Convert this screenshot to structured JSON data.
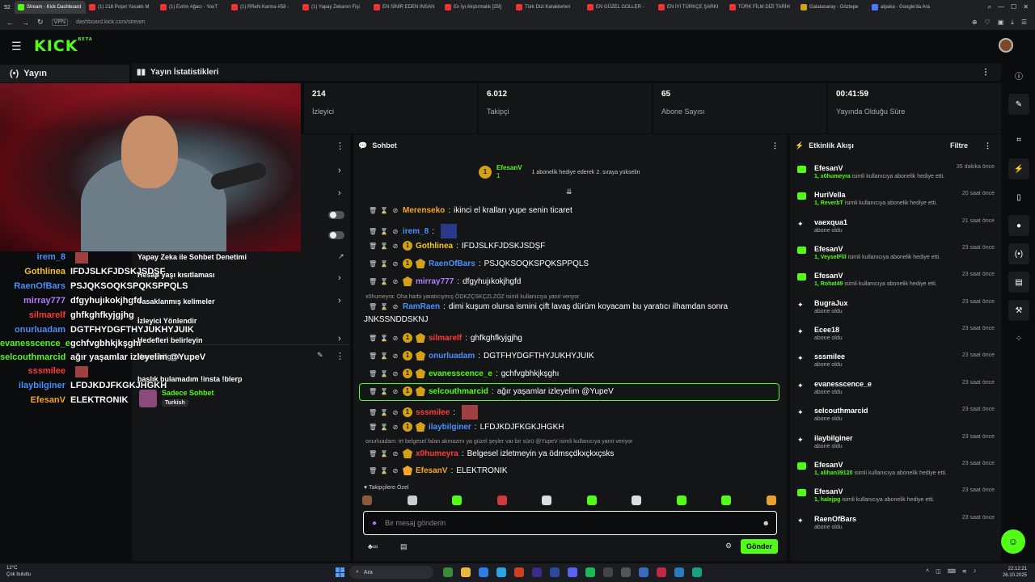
{
  "browser": {
    "tab_count": "52",
    "tabs": [
      {
        "label": "Stream - Kick Dashboard",
        "color": "g",
        "active": true
      },
      {
        "label": "(1) 218 Poşet Yasaklı M",
        "color": "r"
      },
      {
        "label": "(1) Evrim Ağacı - YouT",
        "color": "r"
      },
      {
        "label": "(1) RReN Karma #58 -",
        "color": "r"
      },
      {
        "label": "(1) Yapay Zekanın Fişi",
        "color": "r"
      },
      {
        "label": "EN SİNİR EDEN İNSAN",
        "color": "r"
      },
      {
        "label": "En İyi Alıştırmalık [25t]",
        "color": "r"
      },
      {
        "label": "Türk Dizi Karakterleri",
        "color": "r"
      },
      {
        "label": "EN GÜZEL GOLLER -",
        "color": "r"
      },
      {
        "label": "EN İYİ TÜRKÇE ŞARKI",
        "color": "r"
      },
      {
        "label": "TÜRK FİLM DİZİ TARİH",
        "color": "r"
      },
      {
        "label": "Galatasaray - Göztepe",
        "color": "y"
      },
      {
        "label": "alpaka - Google'da Ara",
        "color": "b"
      }
    ],
    "url_prefix": "VPN",
    "url": "dashboard.kick.com/stream"
  },
  "header": {
    "logo": "KICK",
    "logo_sup": "BETA"
  },
  "left_nav": {
    "label": "Yayın"
  },
  "stats": {
    "title": "Yayın İstatistikleri",
    "items": [
      {
        "value": "214",
        "label": "İzleyici"
      },
      {
        "value": "6.012",
        "label": "Takipçi"
      },
      {
        "value": "65",
        "label": "Abone Sayısı"
      },
      {
        "value": "00:41:59",
        "label": "Yayında Olduğu Süre"
      }
    ]
  },
  "overlay_chat": [
    {
      "user": "irem_8",
      "text": "",
      "color": "#4a90ff"
    },
    {
      "user": "Gothlinea",
      "text": "IFDJSLKFJDSKJSDŞF",
      "color": "#f5c518"
    },
    {
      "user": "RaenOfBars",
      "text": "PSJQKSOQKSPQKSPPQLS",
      "color": "#4a90ff"
    },
    {
      "user": "mirray777",
      "text": "dfgyhujıkokjhgfd",
      "color": "#b57cff"
    },
    {
      "user": "silmarelf",
      "text": "ghfkghfkyjgjhg",
      "color": "#ff3b3b"
    },
    {
      "user": "onurluadam",
      "text": "DGTFHYDGFTHYJUKHYJUIK",
      "color": "#4a90ff"
    },
    {
      "user": "evanesscence_e",
      "text": "gchfvgbhkjkşghı",
      "color": "#53fc18"
    },
    {
      "user": "selcouthmarcid",
      "text": "ağır yaşamlar izleyelim @YupeV",
      "color": "#53fc18"
    },
    {
      "user": "sssmilee",
      "text": "",
      "color": "#ff3b3b"
    },
    {
      "user": "ilaybilginer",
      "text": "LFDJKDJFKGKJHGKH",
      "color": "#4a90ff"
    },
    {
      "user": "EfesanV",
      "text": "ELEKTRONIK",
      "color": "#f5a623"
    }
  ],
  "mid_panel": {
    "ai_title": "Yapay Zeka ile Sohbet Denetimi",
    "age_limit": "Hesap yaşı kısıtlaması",
    "banned_words": "Yasaklanmış kelimeler",
    "redirect": "İzleyici Yönlendir",
    "redirect_sub": "Hedefleri belirleyin",
    "info_title": "Yayın bilgisi",
    "stream_title": "başlık bulamadım !insta !blerp",
    "mode": "Sadece Sohbet",
    "language": "Turkish"
  },
  "chat": {
    "title": "Sohbet",
    "pinned_user": "EfesanV",
    "pinned_level": "1",
    "pinned_text": "1 abonelik hediye ederek 2. sıraya yükselin",
    "messages": [
      {
        "user": "Merenseko",
        "text": "ikinci el kralları yupe senin ticaret",
        "color": "#f5a623",
        "badges": ""
      },
      {
        "user": "irem_8",
        "text": "",
        "color": "#4a90ff",
        "badges": "",
        "emote": true
      },
      {
        "user": "Gothlinea",
        "text": "IFDJSLKFJDSKJSDŞF",
        "color": "#f5c518",
        "badges": "1"
      },
      {
        "user": "RaenOfBars",
        "text": "PSJQKSOQKSPQKSPPQLS",
        "color": "#4a90ff",
        "badges": "1s"
      },
      {
        "user": "mirray777",
        "text": "dfgyhujıkokjhgfd",
        "color": "#b57cff",
        "badges": "s"
      },
      {
        "user": "RamRaen",
        "text": "dimi kuşum olursa ismini çift lavaş dürüm koyacam bu yaratıcı ilhamdan sonra",
        "text2": "JNKSSNDDSKNJ",
        "color": "#4a90ff",
        "badges": ""
      },
      {
        "user": "silmarelf",
        "text": "ghfkghfkyjgjhg",
        "color": "#ff3b3b",
        "badges": "1s"
      },
      {
        "user": "onurluadam",
        "text": "DGTFHYDGFTHYJUKHYJUIK",
        "color": "#4a90ff",
        "badges": "1s"
      },
      {
        "user": "evanesscence_e",
        "text": "gchfvgbhkjkşghı",
        "color": "#53fc18",
        "badges": "1s"
      },
      {
        "user": "selcouthmarcid",
        "text": "ağır yaşamlar izleyelim @YupeV",
        "color": "#53fc18",
        "badges": "1s"
      },
      {
        "user": "sssmilee",
        "text": "",
        "color": "#ff3b3b",
        "badges": "1",
        "emote": true
      },
      {
        "user": "ilaybilginer",
        "text": "LFDJKDJFKGKJHGKH",
        "color": "#4a90ff",
        "badges": "1s"
      },
      {
        "user": "x0humeyra",
        "text": "Belgesel izletmeyin ya ödmsçdkxçkxçsks",
        "color": "#ff3b3b",
        "badges": "s"
      },
      {
        "user": "EfesanV",
        "text": "ELEKTRONIK",
        "color": "#f5a623",
        "badges": "c"
      }
    ],
    "reply1": "x0humeyra: Oha harbi yaratıcıymış ÖDKZÇSKÇZLZÖZ isimli kullanıcıya yanıt veriyor",
    "reply2": "onurluadam: trt belgesel falan akmazmı ya güzel şeyler var bir sürü @YupeV isimli kullanıcıya yanıt veriyor",
    "emote_label": "Takipçilere Özel",
    "input_placeholder": "Bir mesaj gönderin",
    "send_label": "Gönder"
  },
  "activity": {
    "title": "Etkinlik Akışı",
    "filter": "Filtre",
    "items": [
      {
        "name": "EfesanV",
        "time": "35 dakika önce",
        "type": "gift",
        "count": "1,",
        "who": "x0humeyra",
        "desc": " isimli kullanıcıya abonelik hediye etti."
      },
      {
        "name": "HuriVella",
        "time": "20 saat önce",
        "type": "gift",
        "count": "1,",
        "who": "ReverbT",
        "desc": " isimli kullanıcıya abonelik hediye etti."
      },
      {
        "name": "vaexqua1",
        "time": "21 saat önce",
        "type": "sub",
        "desc": "abone oldu"
      },
      {
        "name": "EfesanV",
        "time": "23 saat önce",
        "type": "gift",
        "count": "1,",
        "who": "VeyselFlil",
        "desc": " isimli kullanıcıya abonelik hediye etti."
      },
      {
        "name": "EfesanV",
        "time": "23 saat önce",
        "type": "gift",
        "count": "1,",
        "who": "Rohat49",
        "desc": " isimli kullanıcıya abonelik hediye etti."
      },
      {
        "name": "BugraJux",
        "time": "23 saat önce",
        "type": "sub",
        "desc": "abone oldu"
      },
      {
        "name": "Ecee18",
        "time": "23 saat önce",
        "type": "sub",
        "desc": "abone oldu"
      },
      {
        "name": "sssmilee",
        "time": "23 saat önce",
        "type": "sub",
        "desc": "abone oldu"
      },
      {
        "name": "evanesscence_e",
        "time": "23 saat önce",
        "type": "sub",
        "desc": "abone oldu"
      },
      {
        "name": "selcouthmarcid",
        "time": "23 saat önce",
        "type": "sub",
        "desc": "abone oldu"
      },
      {
        "name": "ilaybilginer",
        "time": "23 saat önce",
        "type": "sub",
        "desc": "abone oldu"
      },
      {
        "name": "EfesanV",
        "time": "23 saat önce",
        "type": "gift",
        "count": "1,",
        "who": "alihan39120",
        "desc": " isimli kullanıcıya abonelik hediye etti."
      },
      {
        "name": "EfesanV",
        "time": "23 saat önce",
        "type": "gift",
        "count": "1,",
        "who": "halejpg",
        "desc": " isimli kullanıcıya abonelik hediye etti."
      },
      {
        "name": "RaenOfBars",
        "time": "23 saat önce",
        "type": "sub",
        "desc": "abone oldu"
      }
    ]
  },
  "taskbar": {
    "temp": "12°C",
    "weather": "Çok bulutlu",
    "search": "Ara",
    "time": "22:12:21",
    "date": "26.10.2025"
  },
  "colors": {
    "accent": "#53fc18",
    "panel": "#141517",
    "bg": "#0b0c0e"
  }
}
